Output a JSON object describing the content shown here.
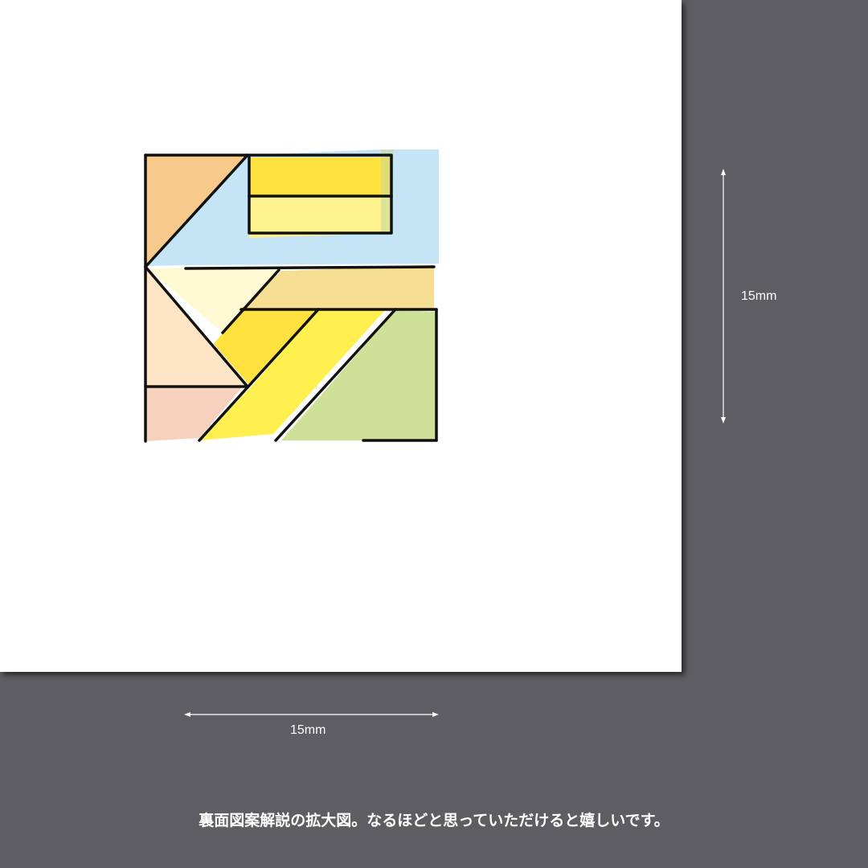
{
  "dimensions": {
    "vertical_label": "15mm",
    "horizontal_label": "15mm"
  },
  "caption": "裏面図案解説の拡大図。なるほどと思っていただけると嬉しいです。",
  "artwork": {
    "icon": "geometric-kanji-mosaic",
    "colors": {
      "background": "#5e5e62",
      "paper": "#ffffff",
      "orange": "#f7c98a",
      "sky_blue": "#c5e5f7",
      "yellow": "#ffe13f",
      "pale_yellow": "#fff38f",
      "cream": "#fff9d4",
      "tan": "#f6df92",
      "peach": "#fde5c6",
      "salmon": "#f6d1bd",
      "bright_yellow": "#fff050",
      "lime": "#cfe098",
      "outline": "#111111"
    }
  }
}
